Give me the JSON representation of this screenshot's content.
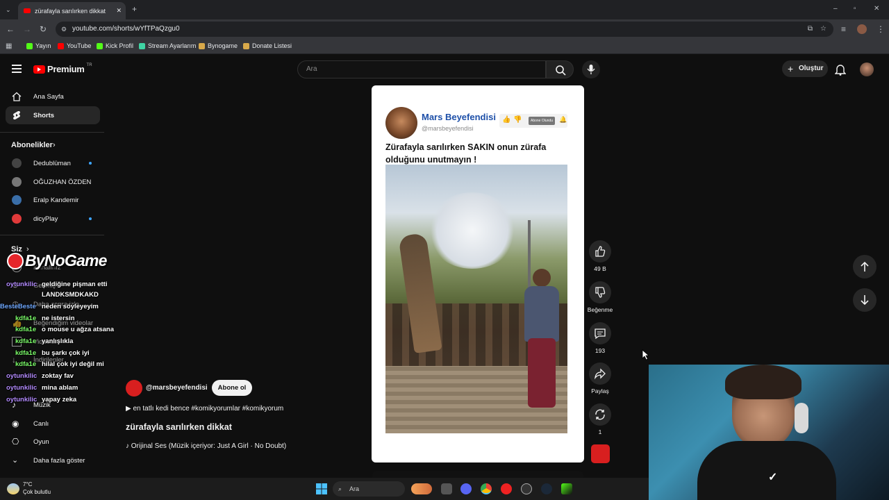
{
  "browser": {
    "tab_title": "zürafayla sarılırken dikkat",
    "url": "youtube.com/shorts/wYfTPaQzgu0",
    "bookmarks": [
      {
        "label": "Yayın",
        "color": "#53fc18"
      },
      {
        "label": "YouTube",
        "color": "#ff0000"
      },
      {
        "label": "Kick Profil",
        "color": "#53fc18"
      },
      {
        "label": "Stream Ayarlarım",
        "color": "#3fd4a4"
      },
      {
        "label": "Bynogame",
        "color": "#d8a94a"
      },
      {
        "label": "Donate Listesi",
        "color": "#d8a94a"
      }
    ]
  },
  "youtube": {
    "logo": "Premium",
    "logo_badge": "TR",
    "search_placeholder": "Ara",
    "create_label": "Oluştur"
  },
  "sidebar": {
    "home": "Ana Sayfa",
    "shorts": "Shorts",
    "subscriptions_header": "Abonelikler",
    "channels": [
      {
        "name": "Dedublüman",
        "color": "#444",
        "new": true
      },
      {
        "name": "OĞUZHAN ÖZDEN",
        "color": "#777",
        "new": false
      },
      {
        "name": "Eralp Kandemir",
        "color": "#3a6ea8",
        "new": false
      },
      {
        "name": "dicyPlay",
        "color": "#e03a3a",
        "new": true
      }
    ],
    "you_header": "Siz",
    "you_items_partial": [
      "Kanalınız",
      "Geçmiş",
      "Daha sonra izle",
      "Beğendiğim videolar",
      "Videolar",
      "İndirilenler"
    ],
    "music": "Müzik",
    "live": "Canlı",
    "gaming": "Oyun",
    "show_more": "Daha fazla göster"
  },
  "overlay": {
    "brand": "ByNoGame",
    "chat": [
      {
        "user": "oytunkilic",
        "user_color": "#b48cff",
        "msg": "geldiğine pişman etti",
        "msg2": "LANDKSMDKAKD"
      },
      {
        "user": "BesteBeste",
        "user_color": "#6fa8ff",
        "msg": "neden söyleyeyim"
      },
      {
        "user": "kdfa1e",
        "user_color": "#7dff6b",
        "msg": "ne istersin"
      },
      {
        "user": "kdfa1e",
        "user_color": "#7dff6b",
        "msg": "o mouse u ağza atsana"
      },
      {
        "user": "kdfa1e",
        "user_color": "#7dff6b",
        "msg": "yanlışlıkla"
      },
      {
        "user": "kdfa1e",
        "user_color": "#7dff6b",
        "msg": "bu şarkı çok iyi"
      },
      {
        "user": "kdfa1e",
        "user_color": "#7dff6b",
        "msg": "hilal çok iyi değil mi"
      },
      {
        "user": "oytunkilic",
        "user_color": "#b48cff",
        "msg": "zoktay fav"
      },
      {
        "user": "oytunkilic",
        "user_color": "#b48cff",
        "msg": "mina ablam"
      },
      {
        "user": "oytunkilic",
        "user_color": "#b48cff",
        "msg": "yapay zeka"
      }
    ]
  },
  "short": {
    "post_author": "Mars Beyefendisi",
    "post_handle": "@marsbeyefendisi",
    "post_sub_chip": "Abone Olundu",
    "post_text": "Zürafayla sarılırken SAKIN onun zürafa olduğunu unutmayın !",
    "channel_handle": "@marsbeyefendisi",
    "subscribe_label": "Abone ol",
    "description": "en tatlı kedi bence #komikyorumlar #komikyorum",
    "title": "zürafayla sarılırken dikkat",
    "music": "Orijinal Ses (Müzik içeriyor: Just A Girl · No Doubt)",
    "likes": "49 B",
    "dislike_label": "Beğenme",
    "comments": "193",
    "share_label": "Paylaş",
    "remix_count": "1"
  },
  "taskbar": {
    "temp": "7°C",
    "weather": "Çok bulutlu",
    "search": "Ara"
  }
}
